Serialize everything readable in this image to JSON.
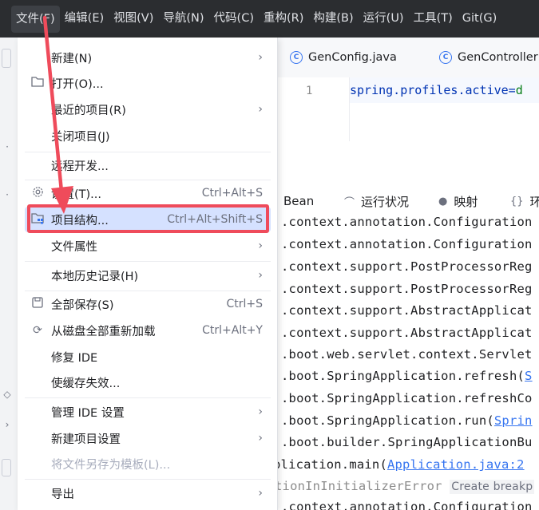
{
  "menubar": {
    "items": [
      "文件(F)",
      "编辑(E)",
      "视图(V)",
      "导航(N)",
      "代码(C)",
      "重构(R)",
      "构建(B)",
      "运行(U)",
      "工具(T)",
      "Git(G)"
    ]
  },
  "editor": {
    "tabs": [
      "GenConfig.java",
      "GenController"
    ],
    "line_number": "1",
    "code": "spring.profiles.active=",
    "code_tail": "d"
  },
  "console": {
    "tabs": [
      "Bean",
      "运行状况",
      "映射",
      "环"
    ],
    "lines": [
      ".context.annotation.Configuration",
      ".context.annotation.Configuration",
      ".context.support.PostProcessorReg",
      ".context.support.PostProcessorReg",
      ".context.support.AbstractApplicat",
      ".context.support.AbstractApplicat",
      ".boot.web.servlet.context.Servlet",
      ".boot.SpringApplication.refresh(",
      ".boot.SpringApplication.refreshCo",
      ".boot.SpringApplication.run(",
      ".boot.builder.SpringApplicationBu",
      "plication.main(",
      "tionInInitializerError",
      ".context.annotation.Configuration"
    ],
    "link_refresh": "S",
    "link_run": "Sprin",
    "link_main": "Application.java:2",
    "hint": "Create breakp"
  },
  "dropdown": {
    "items": [
      {
        "label": "新建(N)",
        "icon": "",
        "shortcut": "",
        "submenu": true
      },
      {
        "label": "打开(O)...",
        "icon": "folder-icon",
        "shortcut": "",
        "submenu": false
      },
      {
        "label": "最近的项目(R)",
        "icon": "",
        "shortcut": "",
        "submenu": true
      },
      {
        "label": "关闭项目(J)",
        "icon": "",
        "shortcut": "",
        "submenu": false
      },
      {
        "label": "远程开发...",
        "icon": "",
        "shortcut": "",
        "submenu": false
      },
      {
        "label": "设置(T)...",
        "icon": "gear-icon",
        "shortcut": "Ctrl+Alt+S",
        "submenu": false
      },
      {
        "label": "项目结构...",
        "icon": "project-structure-icon",
        "shortcut": "Ctrl+Alt+Shift+S",
        "submenu": false,
        "selected": true
      },
      {
        "label": "文件属性",
        "icon": "",
        "shortcut": "",
        "submenu": true
      },
      {
        "label": "本地历史记录(H)",
        "icon": "",
        "shortcut": "",
        "submenu": true
      },
      {
        "label": "全部保存(S)",
        "icon": "save-icon",
        "shortcut": "Ctrl+S",
        "submenu": false
      },
      {
        "label": "从磁盘全部重新加载",
        "icon": "reload-icon",
        "shortcut": "Ctrl+Alt+Y",
        "submenu": false
      },
      {
        "label": "修复 IDE",
        "icon": "",
        "shortcut": "",
        "submenu": false
      },
      {
        "label": "使缓存失效...",
        "icon": "",
        "shortcut": "",
        "submenu": false
      },
      {
        "label": "管理 IDE 设置",
        "icon": "",
        "shortcut": "",
        "submenu": true
      },
      {
        "label": "新建项目设置",
        "icon": "",
        "shortcut": "",
        "submenu": true
      },
      {
        "label": "将文件另存为模板(L)...",
        "icon": "",
        "shortcut": "",
        "submenu": false,
        "disabled": true
      },
      {
        "label": "导出",
        "icon": "",
        "shortcut": "",
        "submenu": true
      }
    ]
  },
  "colors": {
    "menubar_bg": "#2b2d30",
    "selection": "#d5e1ff",
    "annotation_red": "#ef4b5b",
    "accent": "#3574f0"
  }
}
